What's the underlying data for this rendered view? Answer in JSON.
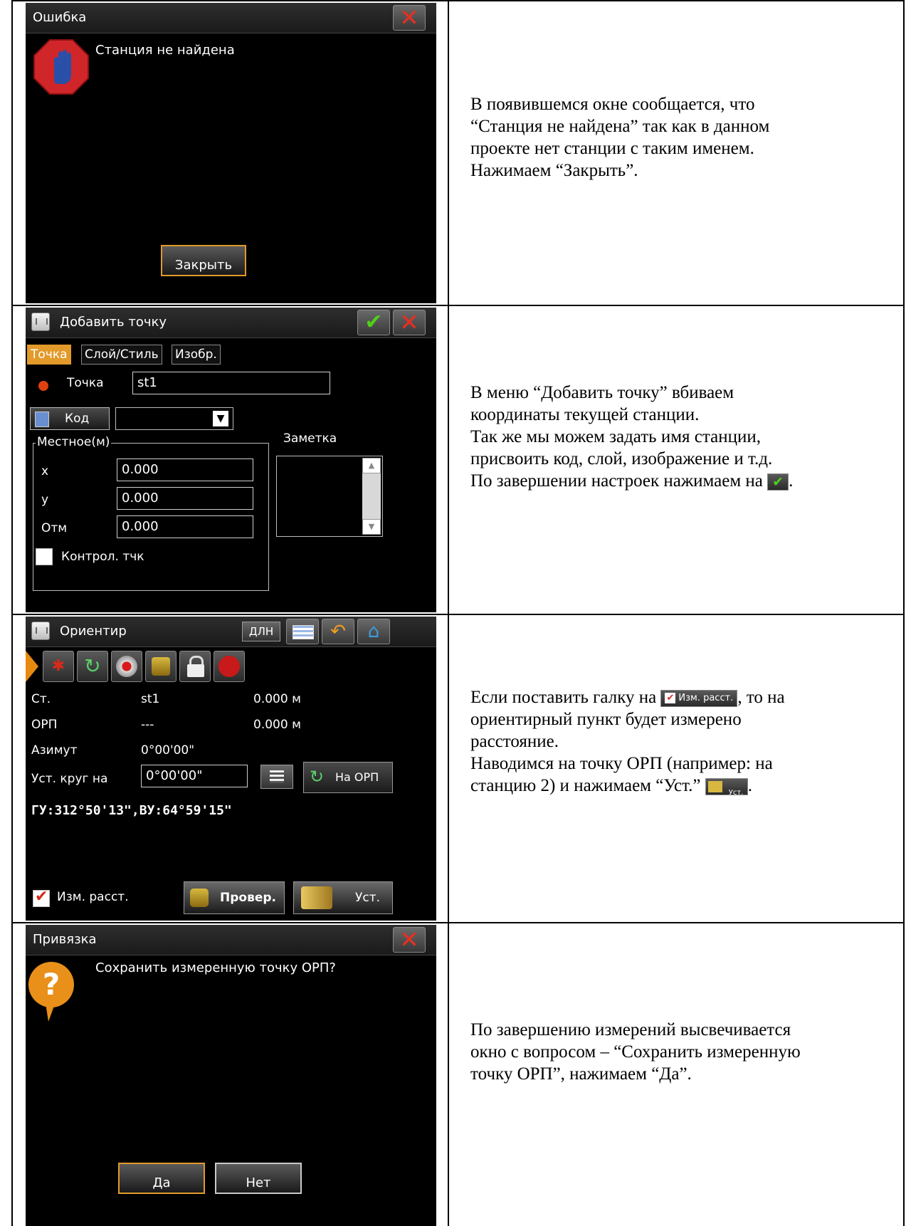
{
  "rows": [
    {
      "screen": {
        "title": "Ошибка",
        "message": "Станция не найдена",
        "close_button": "Закрыть"
      },
      "description": [
        "В появившемся окне сообщается, что",
        "“Станция не найдена” так как в данном",
        "проекте нет станции с таким именем.",
        "Нажимаем “Закрыть”."
      ]
    },
    {
      "screen": {
        "title": "Добавить точку",
        "tabs": [
          "Точка",
          "Слой/Стиль",
          "Изобр."
        ],
        "point_label": "Точка",
        "point_value": "st1",
        "code_button": "Код",
        "group_label": "Местное(м)",
        "fields": [
          {
            "label": "x",
            "value": "0.000"
          },
          {
            "label": "y",
            "value": "0.000"
          },
          {
            "label": "Отм",
            "value": "0.000"
          }
        ],
        "note_label": "Заметка",
        "control_checkbox": "Контрол. тчк"
      },
      "description": [
        "В меню “Добавить точку” вбиваем",
        "координаты текущей станции.",
        "Так же мы можем задать имя станции,",
        "присвоить код, слой, изображение и т.д.",
        "По завершении настроек нажимаем на"
      ],
      "description_end": "."
    },
    {
      "screen": {
        "title": "Ориентир",
        "dln_button": "ДЛН",
        "rows": [
          {
            "label": "Ст.",
            "value": "st1",
            "dist": "0.000 м"
          },
          {
            "label": "ОРП",
            "value": "---",
            "dist": "0.000 м"
          },
          {
            "label": "Азимут",
            "value": "0°00'00\"",
            "dist": ""
          }
        ],
        "set_circle_label": "Уст. круг на",
        "set_circle_value": "0°00'00\"",
        "to_orp_button": "На ОРП",
        "angles": "ГУ:312°50'13\",ВУ:64°59'15\"",
        "measure_dist_label": "Изм. расст.",
        "check_button": "Провер.",
        "set_button": "Уст."
      },
      "description_parts": {
        "before_icon": "Если поставить галку на ",
        "icon_label": "Изм. расст.",
        "after_icon": ", то на",
        "lines": [
          "ориентирный пункт будет измерено",
          "расстояние.",
          "Наводимся на точку ОРП (например: на"
        ],
        "last_before_icon": "станцию 2) и нажимаем “Уст.” ",
        "set_icon_label": "Уст.",
        "last_end": "."
      }
    },
    {
      "screen": {
        "title": "Привязка",
        "message": "Сохранить измеренную точку ОРП?",
        "yes_button": "Да",
        "no_button": "Нет"
      },
      "description": [
        "По завершению измерений высвечивается",
        "окно с вопросом – “Сохранить измеренную",
        "точку ОРП”, нажимаем “Да”."
      ]
    }
  ]
}
